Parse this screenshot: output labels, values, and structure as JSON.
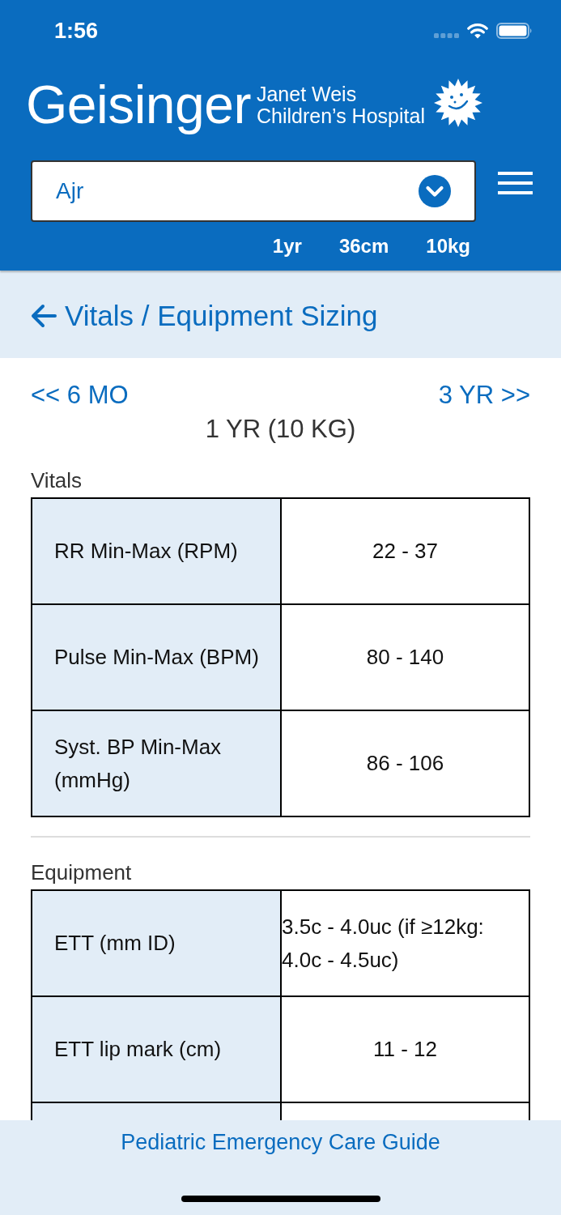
{
  "status_bar": {
    "time": "1:56"
  },
  "header": {
    "logo_text": "Geisinger",
    "logo_subtitle": [
      "Janet Weis",
      "Children’s Hospital"
    ]
  },
  "patient_select": {
    "value": "Ajr"
  },
  "patient_stats": [
    "1yr",
    "36cm",
    "10kg"
  ],
  "title_bar": {
    "title": "Vitals / Equipment Sizing"
  },
  "age_nav": {
    "previous": "<< 6 MO",
    "next": "3 YR >>",
    "current": "1 YR (10 KG)"
  },
  "sections": [
    {
      "heading": "Vitals",
      "continues": false,
      "rows": [
        {
          "label": "RR Min-Max (RPM)",
          "value": "22 - 37"
        },
        {
          "label": "Pulse Min-Max (BPM)",
          "value": "80 - 140"
        },
        {
          "label": "Syst. BP Min-Max (mmHg)",
          "value": "86 - 106"
        }
      ]
    },
    {
      "heading": "Equipment",
      "continues": true,
      "rows": [
        {
          "label": "ETT (mm ID)",
          "value": "3.5c - 4.0uc (if ≥12kg: 4.0c - 4.5uc)"
        },
        {
          "label": "ETT lip mark (cm)",
          "value": "11 - 12"
        }
      ]
    }
  ],
  "footer": {
    "title": "Pediatric Emergency Care Guide"
  }
}
